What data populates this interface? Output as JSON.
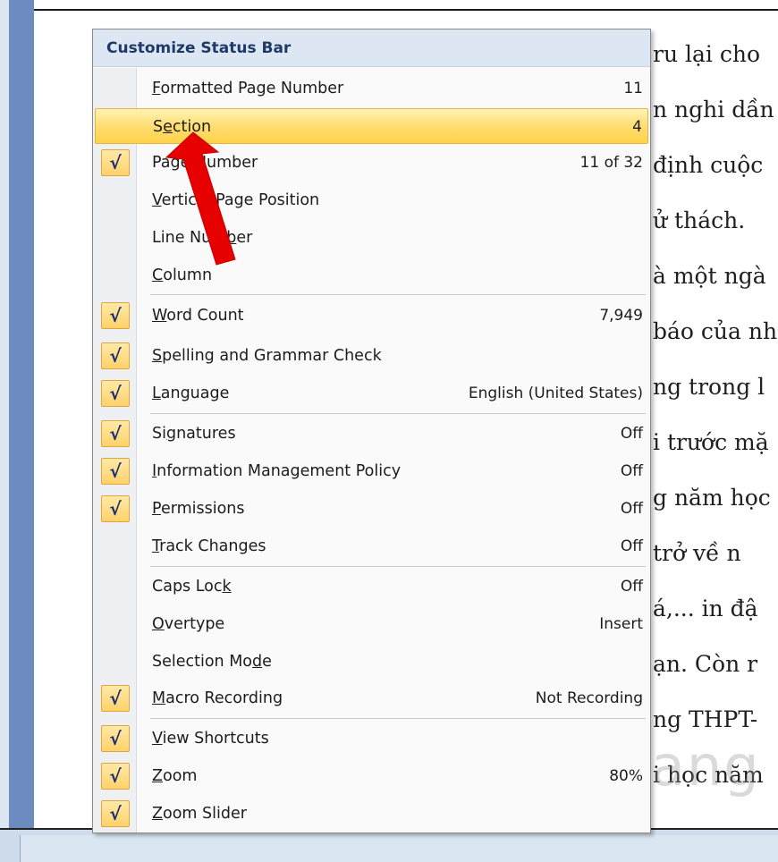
{
  "document": {
    "lines": [
      "ru lại cho",
      "n nghi dần",
      "định cuộc",
      "ử thách.",
      "à một ngà",
      "báo của nh",
      "ng trong l",
      "i trước mặ",
      "g năm học",
      "trở về n",
      "á,... in đậ",
      "ạn. Còn r",
      "ng THPT-",
      "i học năm"
    ]
  },
  "menu": {
    "title": "Customize Status Bar",
    "items": [
      {
        "label": "Formatted Page Number",
        "value": "11",
        "checked": false,
        "mn": "F"
      },
      {
        "label": "Section",
        "value": "4",
        "checked": false,
        "mn": "e",
        "highlight": true
      },
      {
        "label": "Page Number",
        "value": "11 of 32",
        "checked": true,
        "mn": "N"
      },
      {
        "label": "Vertical Page Position",
        "value": "",
        "checked": false,
        "mn": "V"
      },
      {
        "label": "Line Number",
        "value": "",
        "checked": false,
        "mn": "b"
      },
      {
        "label": "Column",
        "value": "",
        "checked": false,
        "mn": "C"
      },
      {
        "label": "Word Count",
        "value": "7,949",
        "checked": true,
        "mn": "W"
      },
      {
        "label": "Spelling and Grammar Check",
        "value": "",
        "checked": true,
        "mn": "S"
      },
      {
        "label": "Language",
        "value": "English (United States)",
        "checked": true,
        "mn": "L"
      },
      {
        "label": "Signatures",
        "value": "Off",
        "checked": true,
        "mn": "g"
      },
      {
        "label": "Information Management Policy",
        "value": "Off",
        "checked": true,
        "mn": "I"
      },
      {
        "label": "Permissions",
        "value": "Off",
        "checked": true,
        "mn": "P"
      },
      {
        "label": "Track Changes",
        "value": "Off",
        "checked": false,
        "mn": "T"
      },
      {
        "label": "Caps Lock",
        "value": "Off",
        "checked": false,
        "mn": "k"
      },
      {
        "label": "Overtype",
        "value": "Insert",
        "checked": false,
        "mn": "O"
      },
      {
        "label": "Selection Mode",
        "value": "",
        "checked": false,
        "mn": "d"
      },
      {
        "label": "Macro Recording",
        "value": "Not Recording",
        "checked": true,
        "mn": "M"
      },
      {
        "label": "View Shortcuts",
        "value": "",
        "checked": true,
        "mn": "V"
      },
      {
        "label": "Zoom",
        "value": "80%",
        "checked": true,
        "mn": "Z"
      },
      {
        "label": "Zoom Slider",
        "value": "",
        "checked": true,
        "mn": "Z"
      }
    ]
  },
  "check_glyph": "√",
  "watermark": "uantrimang",
  "colors": {
    "accent_arrow": "#e60000",
    "highlight": "#ffd24a",
    "menu_header": "#1f3a68"
  }
}
